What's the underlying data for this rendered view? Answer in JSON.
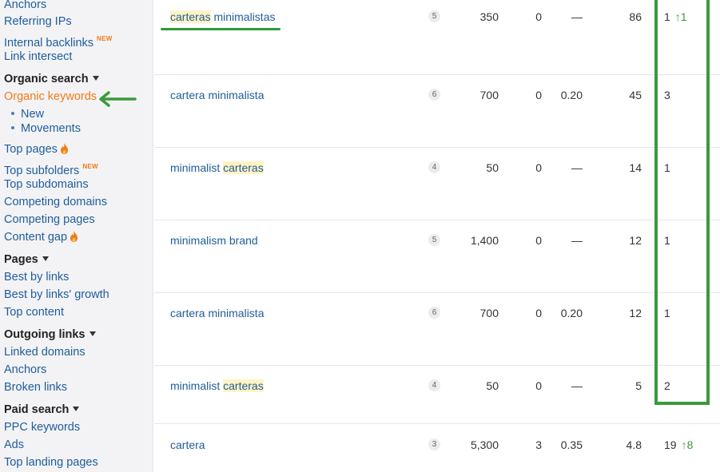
{
  "sidebar": {
    "items_top": [
      {
        "label": "Anchors"
      },
      {
        "label": "Referring IPs"
      },
      {
        "label": "Internal backlinks",
        "badge": "NEW"
      },
      {
        "label": "Link intersect"
      }
    ],
    "organic_search": {
      "heading": "Organic search",
      "organic_keywords": "Organic keywords",
      "sub": [
        "New",
        "Movements"
      ],
      "items": [
        {
          "label": "Top pages",
          "icon": "fire-icon"
        },
        {
          "label": "Top subfolders",
          "badge": "NEW"
        },
        {
          "label": "Top subdomains"
        },
        {
          "label": "Competing domains"
        },
        {
          "label": "Competing pages"
        },
        {
          "label": "Content gap",
          "icon": "fire-icon"
        }
      ]
    },
    "pages": {
      "heading": "Pages",
      "items": [
        "Best by links",
        "Best by links' growth",
        "Top content"
      ]
    },
    "outgoing_links": {
      "heading": "Outgoing links",
      "items": [
        "Linked domains",
        "Anchors",
        "Broken links"
      ]
    },
    "paid_search": {
      "heading": "Paid search",
      "items": [
        "PPC keywords",
        "Ads",
        "Top landing pages"
      ]
    }
  },
  "rows": [
    {
      "kw_parts": [
        {
          "t": "carteras",
          "hl": true
        },
        {
          "t": " minimalistas",
          "hl": false
        }
      ],
      "kd": "5",
      "volume": "350",
      "gv": "0",
      "cpc": "—",
      "traffic": "86",
      "position": "1",
      "change": "1"
    },
    {
      "kw_parts": [
        {
          "t": "cartera minimalista",
          "hl": false
        }
      ],
      "kd": "6",
      "volume": "700",
      "gv": "0",
      "cpc": "0.20",
      "traffic": "45",
      "position": "3",
      "change": ""
    },
    {
      "kw_parts": [
        {
          "t": "minimalist ",
          "hl": false
        },
        {
          "t": "carteras",
          "hl": true
        }
      ],
      "kd": "4",
      "volume": "50",
      "gv": "0",
      "cpc": "—",
      "traffic": "14",
      "position": "1",
      "change": ""
    },
    {
      "kw_parts": [
        {
          "t": "minimalism brand",
          "hl": false
        }
      ],
      "kd": "5",
      "volume": "1,400",
      "gv": "0",
      "cpc": "—",
      "traffic": "12",
      "position": "1",
      "change": ""
    },
    {
      "kw_parts": [
        {
          "t": "cartera minimalista",
          "hl": false
        }
      ],
      "kd": "6",
      "volume": "700",
      "gv": "0",
      "cpc": "0.20",
      "traffic": "12",
      "position": "1",
      "change": ""
    },
    {
      "kw_parts": [
        {
          "t": "minimalist ",
          "hl": false
        },
        {
          "t": "carteras",
          "hl": true
        }
      ],
      "kd": "4",
      "volume": "50",
      "gv": "0",
      "cpc": "—",
      "traffic": "5",
      "position": "2",
      "change": ""
    },
    {
      "kw_parts": [
        {
          "t": "cartera",
          "hl": false
        }
      ],
      "kd": "3",
      "volume": "5,300",
      "gv": "3",
      "cpc": "0.35",
      "traffic": "4.8",
      "position": "19",
      "change": "8"
    }
  ],
  "colors": {
    "annotation_green": "#3a9a3c",
    "active_orange": "#f07a17",
    "link_blue": "#1f5d9b"
  }
}
